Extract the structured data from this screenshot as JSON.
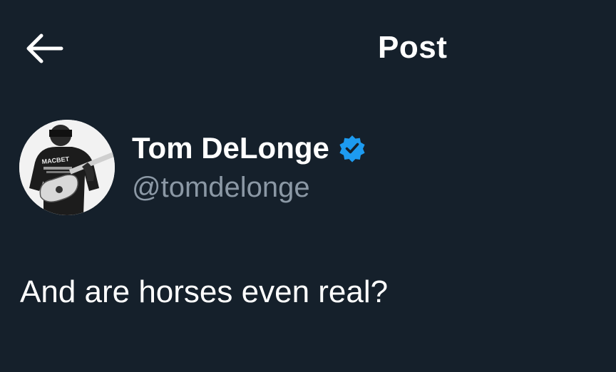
{
  "header": {
    "title": "Post",
    "back_icon": "arrow-left-icon"
  },
  "author": {
    "display_name": "Tom DeLonge",
    "handle": "@tomdelonge",
    "verified": true,
    "verified_icon": "verified-badge-icon",
    "avatar_text": "MACBET"
  },
  "post": {
    "text": "And are horses even real?"
  },
  "colors": {
    "background": "#15202b",
    "text_primary": "#ffffff",
    "text_secondary": "#8b98a5",
    "verified_blue": "#1d9bf0"
  }
}
